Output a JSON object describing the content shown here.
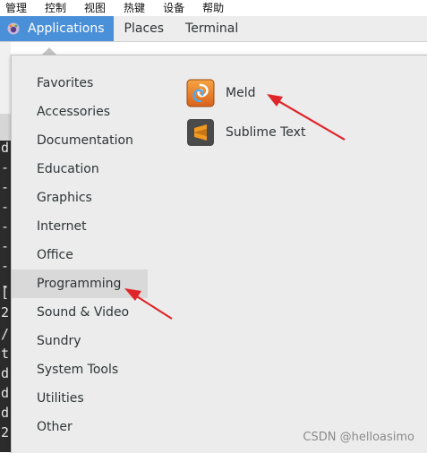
{
  "host_menubar": {
    "items": [
      "管理",
      "控制",
      "视图",
      "热键",
      "设备",
      "帮助"
    ]
  },
  "panel": {
    "items": [
      {
        "label": "Applications",
        "icon": "gnome-foot-icon",
        "active": true
      },
      {
        "label": "Places"
      },
      {
        "label": "Terminal"
      }
    ]
  },
  "background_terminal": {
    "visible_chars": [
      "d",
      "-",
      "-",
      "-",
      "-",
      "-",
      "-",
      "-",
      "[",
      "2",
      "/",
      "t",
      "d",
      "d",
      "d",
      "2"
    ]
  },
  "applications_menu": {
    "categories": [
      "Favorites",
      "Accessories",
      "Documentation",
      "Education",
      "Graphics",
      "Internet",
      "Office",
      "Programming",
      "Sound & Video",
      "Sundry",
      "System Tools",
      "Utilities",
      "Other"
    ],
    "selected_category": "Programming",
    "apps": [
      {
        "label": "Meld",
        "icon": "meld-icon"
      },
      {
        "label": "Sublime Text",
        "icon": "sublime-text-icon"
      }
    ]
  },
  "annotations": {
    "arrow_color": "#e0262b"
  },
  "watermark": "CSDN @helloasimo",
  "colors": {
    "panel_active": "#4a90d9",
    "menu_bg": "#ececec",
    "selected_bg": "#d9d9d9"
  }
}
